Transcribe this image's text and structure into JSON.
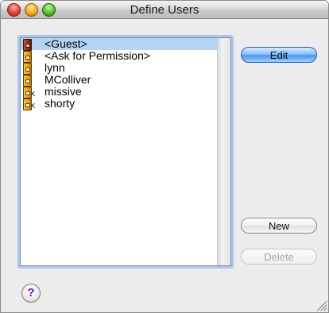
{
  "window": {
    "title": "Define Users"
  },
  "users": [
    {
      "name": "<Guest>",
      "selected": true,
      "icon": "user-icon-dark",
      "disabled_mark": ""
    },
    {
      "name": "<Ask for Permission>",
      "selected": false,
      "icon": "user-icon",
      "disabled_mark": ""
    },
    {
      "name": "lynn",
      "selected": false,
      "icon": "user-icon",
      "disabled_mark": ""
    },
    {
      "name": "MColliver",
      "selected": false,
      "icon": "user-icon",
      "disabled_mark": ""
    },
    {
      "name": "missive",
      "selected": false,
      "icon": "user-icon",
      "disabled_mark": "x"
    },
    {
      "name": "shorty",
      "selected": false,
      "icon": "user-icon",
      "disabled_mark": "x"
    }
  ],
  "buttons": {
    "edit": "Edit",
    "new": "New",
    "delete": "Delete",
    "help": "?"
  }
}
